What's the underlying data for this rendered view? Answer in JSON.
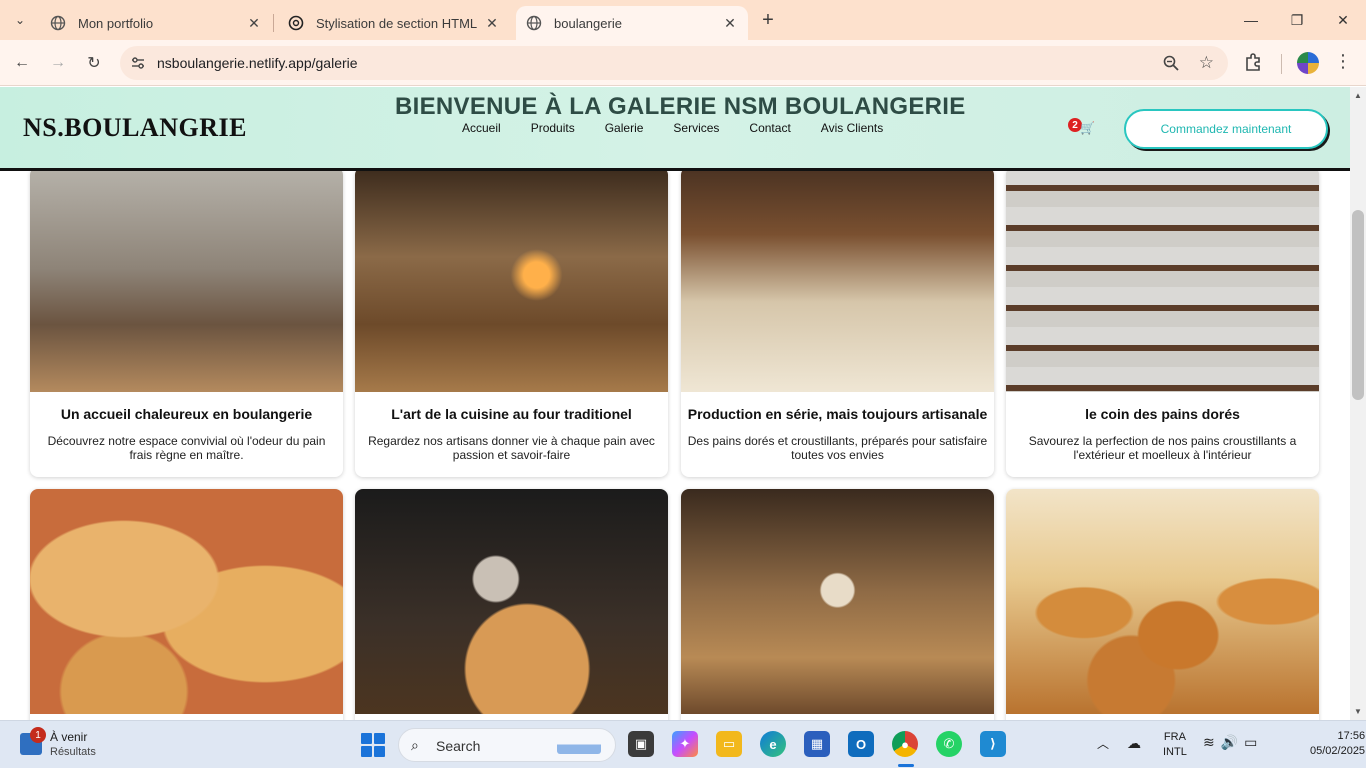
{
  "browser": {
    "tabs": [
      {
        "title": "Mon portfolio",
        "active": false
      },
      {
        "title": "Stylisation de section HTML",
        "active": false
      },
      {
        "title": "boulangerie",
        "active": true
      }
    ],
    "url": "nsboulangerie.netlify.app/galerie"
  },
  "site": {
    "logo": "NS.BOULANGRIE",
    "gallery_title": "BIENVENUE À LA GALERIE NSM BOULANGERIE",
    "nav": [
      "Accueil",
      "Produits",
      "Galerie",
      "Services",
      "Contact",
      "Avis Clients"
    ],
    "cart_count": "2",
    "order_button": "Commandez maintenant"
  },
  "gallery": [
    {
      "title": "Un accueil chaleureux en boulangerie",
      "description": "Découvrez notre espace convivial où l'odeur du pain frais règne en maître."
    },
    {
      "title": "L'art de la cuisine au four traditionel",
      "description": "Regardez nos artisans donner vie à chaque pain avec passion et savoir-faire"
    },
    {
      "title": "Production en série, mais toujours artisanale",
      "description": "Des pains dorés et croustillants, préparés pour satisfaire toutes vos envies"
    },
    {
      "title": "le coin des pains dorés",
      "description": "Savourez la perfection de nos pains croustillants a l'extérieur et moelleux à l'intérieur"
    },
    {
      "title": "",
      "description": ""
    },
    {
      "title": "",
      "description": ""
    },
    {
      "title": "",
      "description": ""
    },
    {
      "title": "",
      "description": ""
    }
  ],
  "taskbar": {
    "weather_line1": "À venir",
    "weather_line2": "Résultats",
    "weather_badge": "1",
    "search_placeholder": "Search",
    "lang_line1": "FRA",
    "lang_line2": "INTL",
    "time": "17:56",
    "date": "05/02/2025"
  }
}
